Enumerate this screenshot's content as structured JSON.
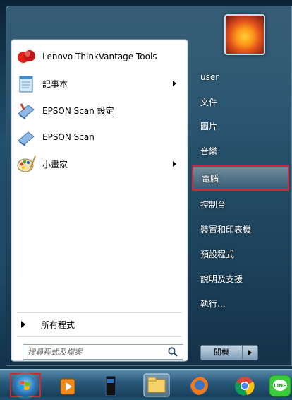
{
  "start_menu": {
    "programs": [
      {
        "label": "Lenovo ThinkVantage Tools",
        "icon": "lenovo-thinkvantage-icon",
        "has_submenu": false
      },
      {
        "label": "記事本",
        "icon": "notepad-icon",
        "has_submenu": true
      },
      {
        "label": "EPSON Scan 設定",
        "icon": "epson-scan-settings-icon",
        "has_submenu": false
      },
      {
        "label": "EPSON Scan",
        "icon": "epson-scan-icon",
        "has_submenu": false
      },
      {
        "label": "小畫家",
        "icon": "paint-icon",
        "has_submenu": true
      }
    ],
    "all_programs_label": "所有程式",
    "search_placeholder": "搜尋程式及檔案",
    "right_items": [
      {
        "label": "user",
        "highlighted": false
      },
      {
        "label": "文件",
        "highlighted": false
      },
      {
        "label": "圖片",
        "highlighted": false
      },
      {
        "label": "音樂",
        "highlighted": false
      },
      {
        "label": "電腦",
        "highlighted": true
      },
      {
        "label": "控制台",
        "highlighted": false
      },
      {
        "label": "裝置和印表機",
        "highlighted": false
      },
      {
        "label": "預設程式",
        "highlighted": false
      },
      {
        "label": "說明及支援",
        "highlighted": false
      },
      {
        "label": "執行...",
        "highlighted": false
      }
    ],
    "shutdown_label": "關機"
  },
  "taskbar": {
    "icons": [
      "start-orb-icon",
      "media-player-icon",
      "desktop-app-icon",
      "file-explorer-icon",
      "firefox-icon",
      "chrome-icon",
      "line-icon"
    ],
    "line_label": "LINE"
  },
  "colors": {
    "highlight_border": "#d0283a",
    "taskbar": "#2a5a7c"
  }
}
